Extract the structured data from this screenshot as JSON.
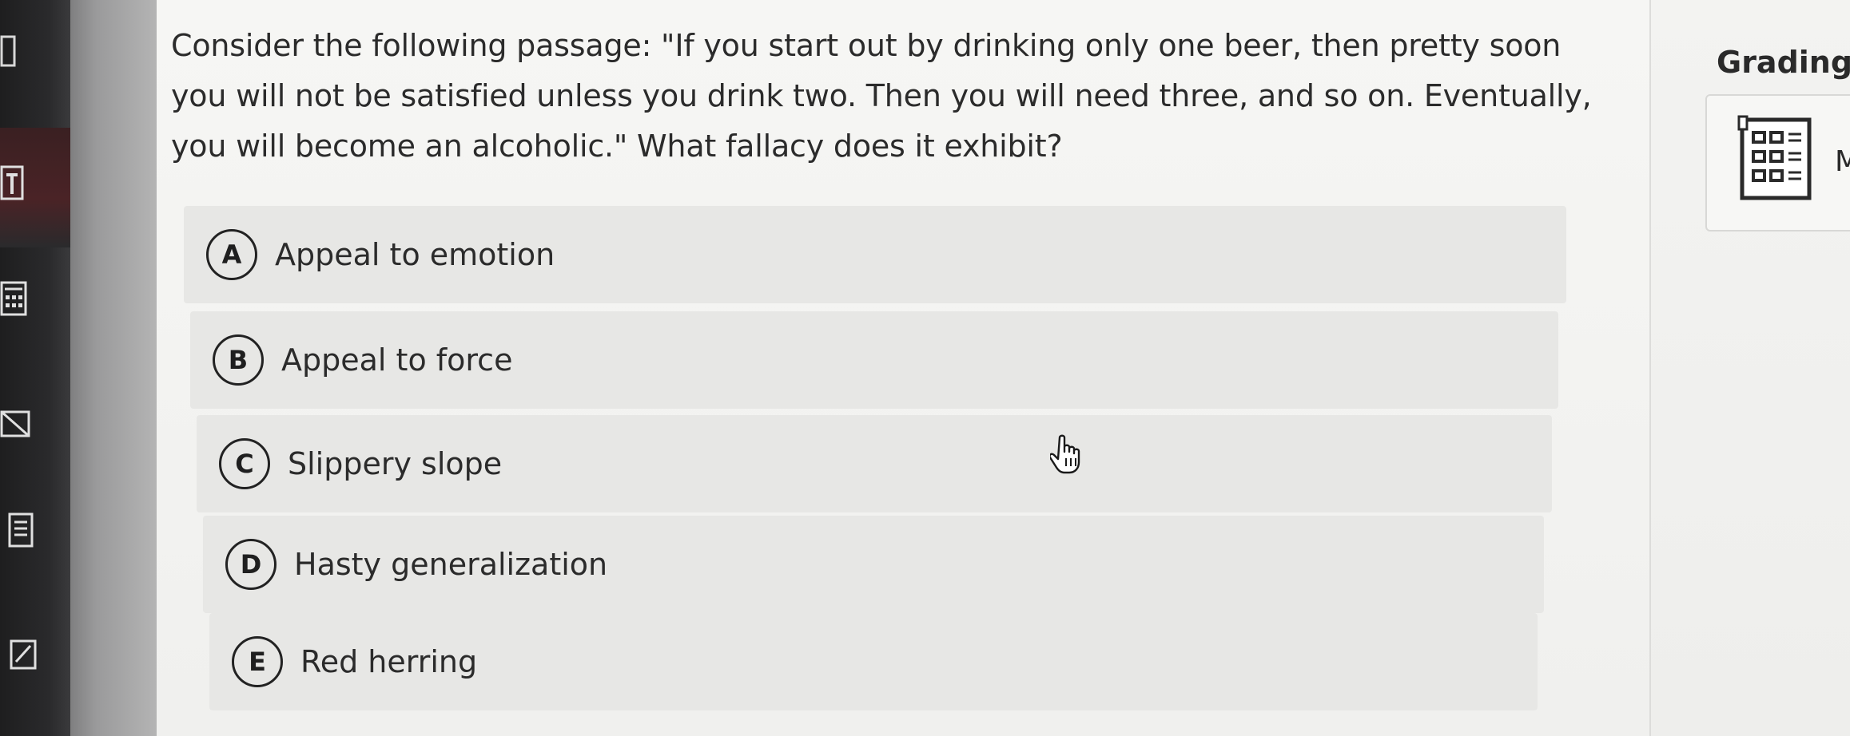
{
  "question": {
    "text": "Consider the following passage: \"If you start out by drinking only one beer, then pretty soon you will not be satisfied unless you drink two. Then you will need three, and so on. Eventually, you will become an alcoholic.\" What fallacy does it exhibit?"
  },
  "options": [
    {
      "letter": "A",
      "label": "Appeal to emotion"
    },
    {
      "letter": "B",
      "label": "Appeal to force"
    },
    {
      "letter": "C",
      "label": "Slippery slope"
    },
    {
      "letter": "D",
      "label": "Hasty generalization"
    },
    {
      "letter": "E",
      "label": "Red herring"
    }
  ],
  "right_panel": {
    "title": "Grading",
    "card_text": "M",
    "card_icon": "calculator-icon"
  },
  "toolbar": {
    "icons": [
      "toolbar-icon",
      "calculator-icon",
      "flag-icon",
      "notes-icon",
      "edit-icon"
    ]
  },
  "cursor": {
    "icon": "hand-pointer-icon"
  }
}
